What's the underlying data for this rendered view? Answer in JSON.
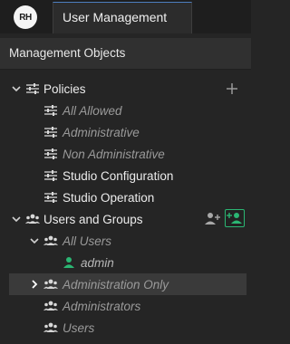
{
  "app": {
    "logo_text": "RH",
    "tab_title": "User Management"
  },
  "panel": {
    "title": "Management Objects"
  },
  "colors": {
    "accent": "#2bb673",
    "tab_border": "#4d7ec0",
    "user_active": "#2bb673"
  },
  "tree": {
    "policies": {
      "label": "Policies",
      "icon": "sliders-icon",
      "items": [
        "All Allowed",
        "Administrative",
        "Non Administrative",
        "Studio Configuration",
        "Studio Operation"
      ]
    },
    "users_groups": {
      "label": "Users and Groups",
      "icon": "users-icon",
      "all_users": {
        "label": "All Users",
        "children": [
          "admin"
        ]
      },
      "groups": [
        "Administration Only",
        "Administrators",
        "Users"
      ]
    }
  }
}
